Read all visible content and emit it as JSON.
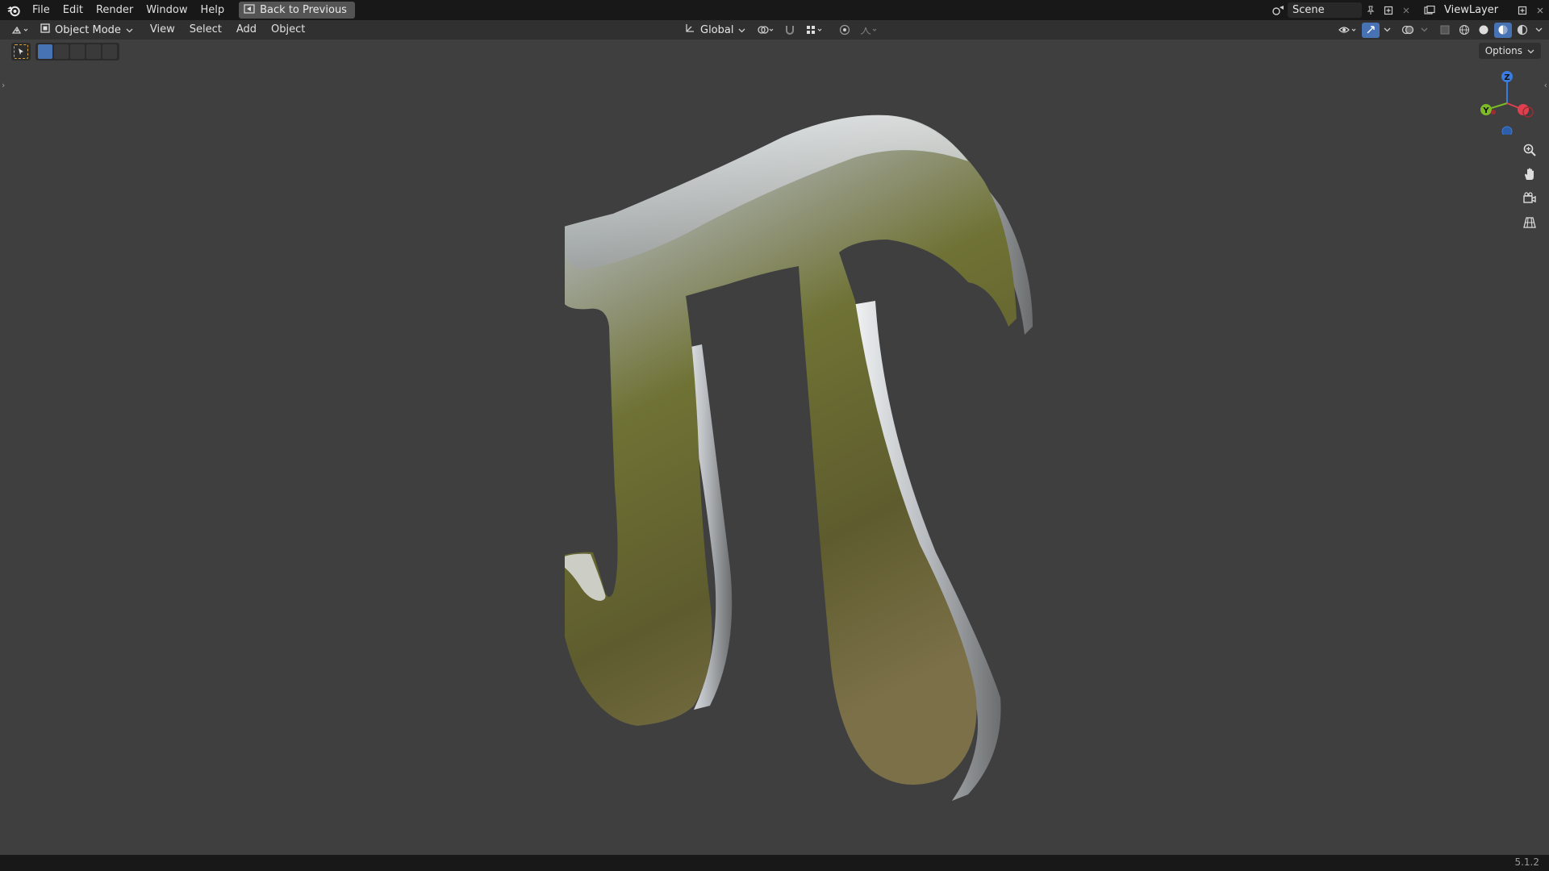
{
  "topbar": {
    "menus": [
      "File",
      "Edit",
      "Render",
      "Window",
      "Help"
    ],
    "back_button": "Back to Previous",
    "scene_name": "Scene",
    "view_layer_name": "ViewLayer",
    "logo_icon": "blender-logo-icon"
  },
  "header": {
    "editor_type_icon": "3d-viewport-icon",
    "mode": "Object Mode",
    "menus": [
      "View",
      "Select",
      "Add",
      "Object"
    ],
    "transform_orientation": "Global",
    "options_label": "Options"
  },
  "viewport": {
    "gizmo": {
      "axes": [
        {
          "label": "Z",
          "color": "#3a7de0"
        },
        {
          "label": "Y",
          "color": "#7cbb25"
        },
        {
          "label": "X",
          "color": "#e0404e"
        }
      ]
    },
    "object_description": "3D pi symbol (π) with metallic material",
    "colors": {
      "background": "#3f3f3f",
      "metal_light": "#d9dde0",
      "metal_dark": "#6b6b2e"
    }
  },
  "statusbar": {
    "version": "5.1.2"
  }
}
